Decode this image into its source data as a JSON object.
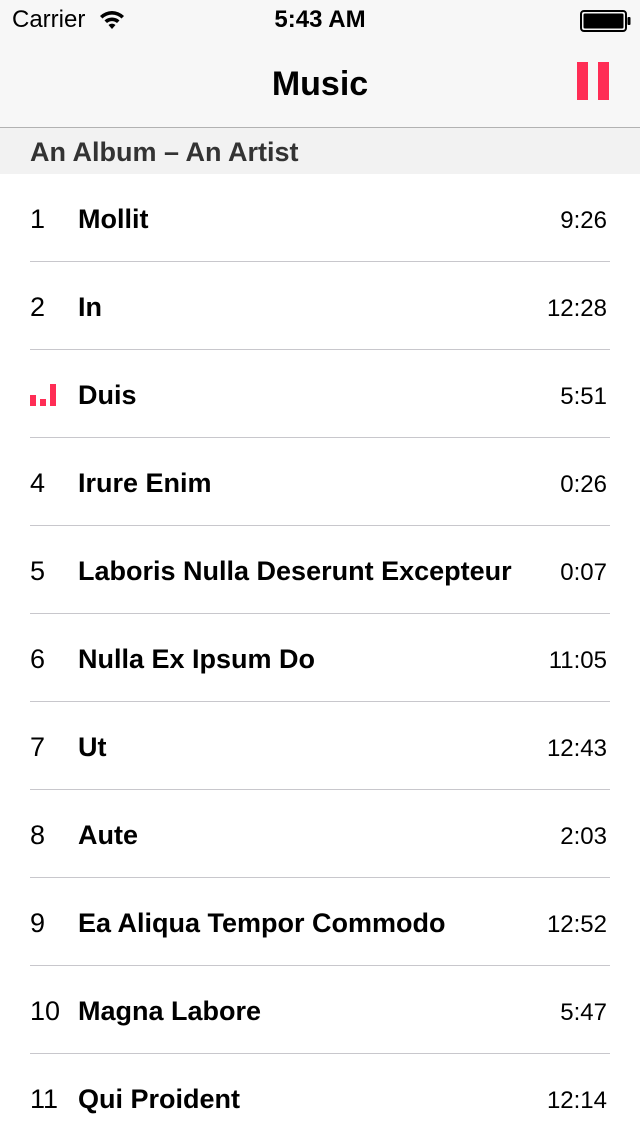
{
  "status_bar": {
    "carrier": "Carrier",
    "time": "5:43 AM",
    "wifi_icon": "wifi-icon",
    "battery_icon": "battery-full-icon"
  },
  "nav": {
    "title": "Music",
    "pause_icon": "pause-icon",
    "accent_color": "#ff2d55"
  },
  "section": {
    "title": "An Album – An Artist"
  },
  "tracks": [
    {
      "number": "1",
      "title": "Mollit",
      "duration": "9:26",
      "playing": false
    },
    {
      "number": "2",
      "title": "In",
      "duration": "12:28",
      "playing": false
    },
    {
      "number": "3",
      "title": "Duis",
      "duration": "5:51",
      "playing": true
    },
    {
      "number": "4",
      "title": "Irure Enim",
      "duration": "0:26",
      "playing": false
    },
    {
      "number": "5",
      "title": "Laboris Nulla Deserunt Excepteur",
      "duration": "0:07",
      "playing": false
    },
    {
      "number": "6",
      "title": "Nulla Ex Ipsum Do",
      "duration": "11:05",
      "playing": false
    },
    {
      "number": "7",
      "title": "Ut",
      "duration": "12:43",
      "playing": false
    },
    {
      "number": "8",
      "title": "Aute",
      "duration": "2:03",
      "playing": false
    },
    {
      "number": "9",
      "title": "Ea Aliqua Tempor Commodo",
      "duration": "12:52",
      "playing": false
    },
    {
      "number": "10",
      "title": "Magna Labore",
      "duration": "5:47",
      "playing": false
    },
    {
      "number": "11",
      "title": "Qui Proident",
      "duration": "12:14",
      "playing": false
    }
  ]
}
